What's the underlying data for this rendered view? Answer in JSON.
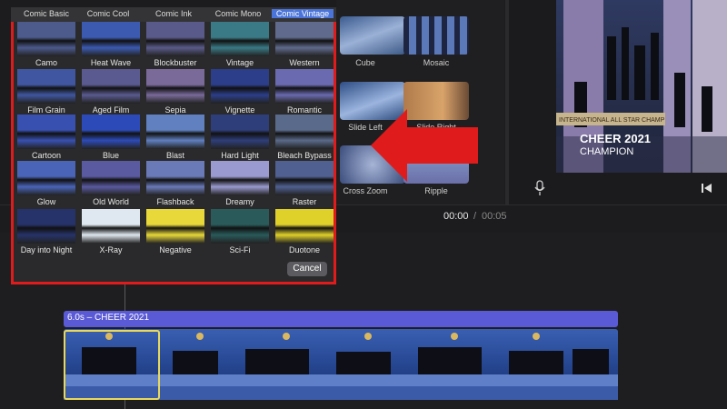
{
  "filters": {
    "header_tabs": [
      {
        "label": "Comic Basic",
        "active": false
      },
      {
        "label": "Comic Cool",
        "active": false
      },
      {
        "label": "Comic Ink",
        "active": false
      },
      {
        "label": "Comic Mono",
        "active": false
      },
      {
        "label": "Comic Vintage",
        "active": true
      }
    ],
    "rows": [
      [
        "Camo",
        "Heat Wave",
        "Blockbuster",
        "Vintage",
        "Western"
      ],
      [
        "Film Grain",
        "Aged Film",
        "Sepia",
        "Vignette",
        "Romantic"
      ],
      [
        "Cartoon",
        "Blue",
        "Blast",
        "Hard Light",
        "Bleach Bypass"
      ],
      [
        "Glow",
        "Old World",
        "Flashback",
        "Dreamy",
        "Raster"
      ],
      [
        "Day into Night",
        "X-Ray",
        "Negative",
        "Sci-Fi",
        "Duotone"
      ]
    ],
    "cancel_label": "Cancel"
  },
  "transitions": {
    "items": [
      "Cube",
      "Mosaic",
      "Slide Left",
      "Slide Right",
      "Cross Zoom",
      "Ripple"
    ]
  },
  "viewer": {
    "overlay_line1": "CHEER 2021",
    "overlay_line2": "CHAMPION",
    "banner_text": "INTERNATIONAL ALL STAR CHAMP"
  },
  "playback": {
    "current_time": "00:00",
    "separator": "/",
    "total_time": "00:05"
  },
  "timeline": {
    "clip_title": "6.0s – CHEER 2021"
  },
  "colors": {
    "highlight_red": "#e01b1b",
    "selection_yellow": "#e8d95b",
    "title_bar_purple": "#5a5ad6",
    "active_tab_blue": "#4a74d9"
  },
  "icons": [
    "microphone-icon",
    "skip-back-icon"
  ]
}
